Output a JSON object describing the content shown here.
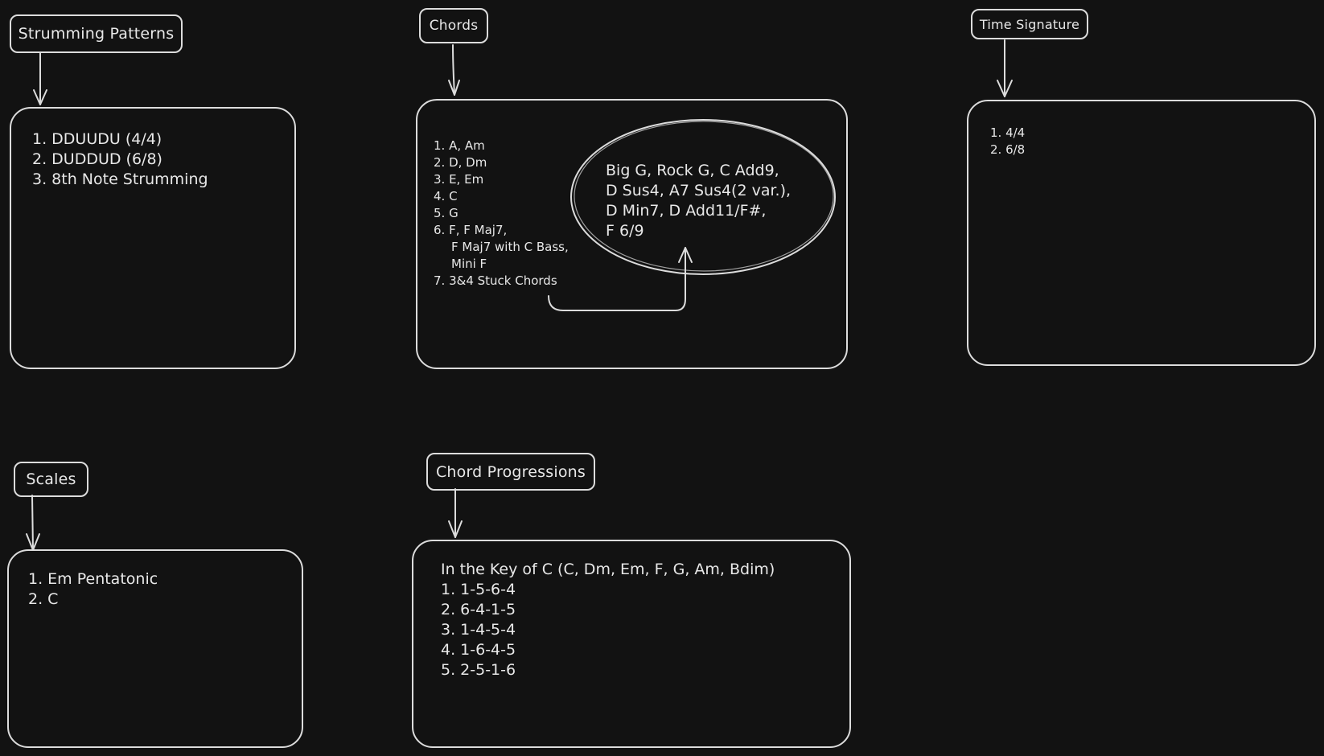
{
  "strumming": {
    "title": "Strumming Patterns",
    "items": [
      "1. DDUUDU (4/4)",
      "2. DUDDUD (6/8)",
      "3. 8th Note Strumming"
    ]
  },
  "chords": {
    "title": "Chords",
    "items": [
      "1. A, Am",
      "2. D, Dm",
      "3. E, Em",
      "4. C",
      "5. G",
      "6. F, F Maj7,",
      "F Maj7 with C Bass,",
      "Mini F",
      "7. 3&4 Stuck Chords"
    ],
    "stuck_chords": [
      "Big G, Rock G, C Add9,",
      "D Sus4, A7 Sus4(2 var.),",
      "D Min7, D Add11/F#,",
      "F 6/9"
    ]
  },
  "time_signature": {
    "title": "Time Signature",
    "items": [
      "1. 4/4",
      "2. 6/8"
    ]
  },
  "scales": {
    "title": "Scales",
    "items": [
      "1. Em Pentatonic",
      "2. C"
    ]
  },
  "progressions": {
    "title": "Chord Progressions",
    "key": "In the Key of C (C, Dm, Em, F, G, Am, Bdim)",
    "items": [
      "1. 1-5-6-4",
      "2. 6-4-1-5",
      "3. 1-4-5-4",
      "4. 1-6-4-5",
      "5. 2-5-1-6"
    ]
  },
  "colors": {
    "background": "#121212",
    "stroke": "#dcdcdc",
    "text": "#e8e8e8"
  }
}
